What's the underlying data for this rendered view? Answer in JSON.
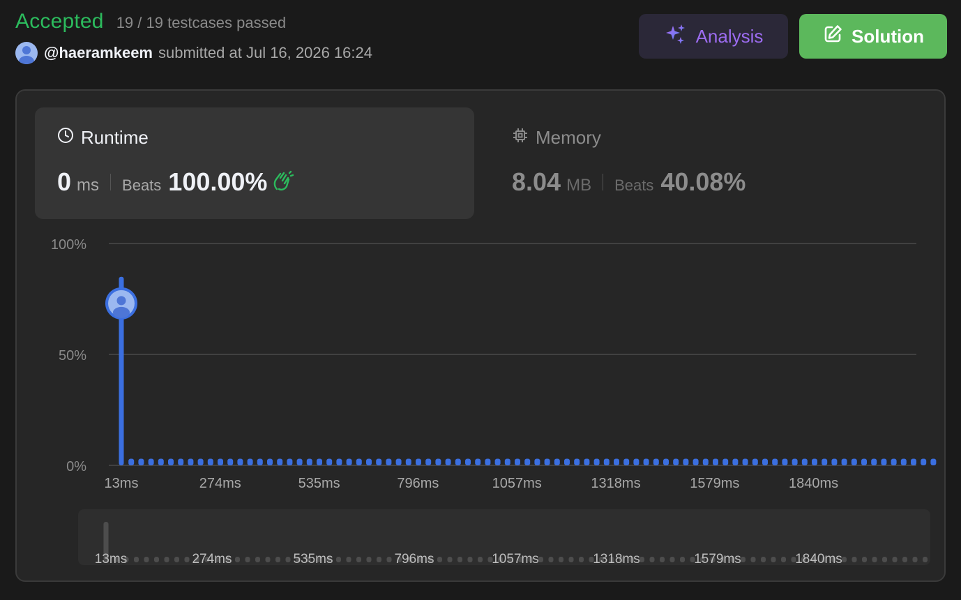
{
  "header": {
    "status": "Accepted",
    "testcases": "19 / 19 testcases passed",
    "username": "@haeramkeem",
    "submitted": "submitted at Jul 16, 2026 16:24"
  },
  "buttons": {
    "analysis": "Analysis",
    "solution": "Solution"
  },
  "runtime": {
    "title": "Runtime",
    "value": "0",
    "unit": "ms",
    "beats_label": "Beats",
    "beats": "100.00%"
  },
  "memory": {
    "title": "Memory",
    "value": "8.04",
    "unit": "MB",
    "beats_label": "Beats",
    "beats": "40.08%"
  },
  "colors": {
    "accepted": "#2cbb5d",
    "bar": "#3b6fe0",
    "solution_btn": "#5cb85c",
    "analysis_text": "#9c6cf0"
  },
  "chart_data": {
    "type": "bar",
    "ylabel_ticks": [
      "100%",
      "50%",
      "0%"
    ],
    "ylim": [
      0,
      100
    ],
    "x_tick_labels": [
      "13ms",
      "274ms",
      "535ms",
      "796ms",
      "1057ms",
      "1318ms",
      "1579ms",
      "1840ms"
    ],
    "series": [
      {
        "values": [
          85,
          3,
          3,
          3,
          3,
          3,
          3,
          3,
          3,
          3,
          3,
          3,
          3,
          3,
          3,
          3,
          3,
          3,
          3,
          3,
          3,
          3,
          3,
          3,
          3,
          3,
          3,
          3,
          3,
          3,
          3,
          3,
          3,
          3,
          3,
          3,
          3,
          3,
          3,
          3,
          3,
          3,
          3,
          3,
          3,
          3,
          3,
          3,
          3,
          3,
          3,
          3,
          3,
          3,
          3,
          3,
          3,
          3,
          3,
          3,
          3,
          3,
          3,
          3,
          3,
          3,
          3,
          3,
          3,
          3,
          3,
          3,
          3,
          3,
          3,
          3,
          3,
          3,
          3,
          3,
          3,
          3,
          3
        ]
      }
    ],
    "your_submission_value": 73,
    "grid": true
  },
  "minimap": {
    "x_tick_labels": [
      "13ms",
      "274ms",
      "535ms",
      "796ms",
      "1057ms",
      "1318ms",
      "1579ms",
      "1840ms"
    ]
  }
}
